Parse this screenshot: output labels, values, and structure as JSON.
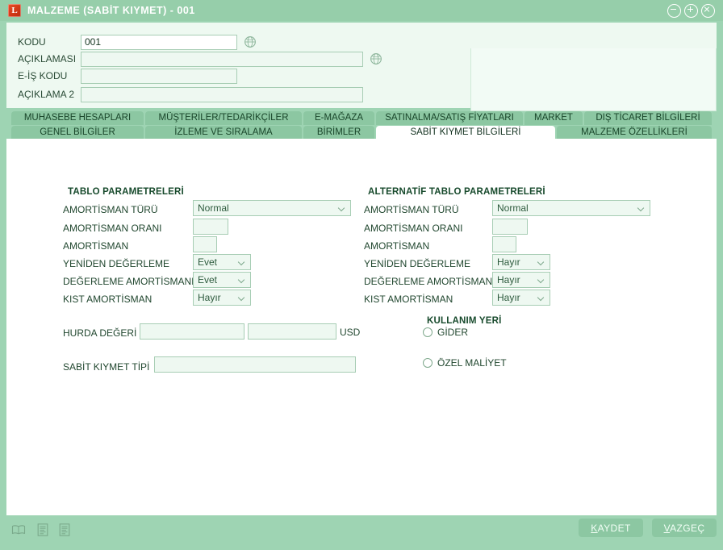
{
  "theme": {
    "window_bg": "#9ed4b3",
    "titlebar_bg": "#96ceaa",
    "tab_bg": "#8cc7a2",
    "tab_active_bg": "#ffffff",
    "content_bg": "#ffffff",
    "field_bg": "#eef8f1",
    "field_border": "#a7cdb4",
    "text": "#21472f",
    "accent_icon": "#e8502a"
  },
  "titlebar": {
    "app_icon": "logo-app-icon",
    "app_icon_letter": "L",
    "title": "MALZEME (SABİT KIYMET) - 001",
    "buttons": [
      {
        "name": "minimize-button",
        "glyph": "minus"
      },
      {
        "name": "maximize-button",
        "glyph": "plus"
      },
      {
        "name": "close-button",
        "glyph": "cross"
      }
    ]
  },
  "header": {
    "fields": [
      {
        "label": "KODU",
        "value": "001",
        "placeholder": "",
        "globe": true
      },
      {
        "label": "AÇIKLAMASI",
        "value": "",
        "placeholder": "",
        "globe": true
      },
      {
        "label": "E-İŞ KODU",
        "value": "",
        "placeholder": "",
        "globe": false
      },
      {
        "label": "AÇIKLAMA 2",
        "value": "",
        "placeholder": "",
        "globe": false
      }
    ],
    "globe_icon": "globe-icon",
    "photo_panel": "item-image-panel"
  },
  "tabs": {
    "row1": [
      {
        "label": "MUHASEBE HESAPLARI",
        "active": false
      },
      {
        "label": "MÜŞTERİLER/TEDARİKÇİLER",
        "active": false
      },
      {
        "label": "E-MAĞAZA",
        "active": false
      },
      {
        "label": "SATINALMA/SATIŞ FİYATLARI",
        "active": false
      },
      {
        "label": "MARKET",
        "active": false
      },
      {
        "label": "DIŞ TİCARET BİLGİLERİ",
        "active": false
      }
    ],
    "row2": [
      {
        "label": "GENEL BİLGİLER",
        "active": false
      },
      {
        "label": "İZLEME VE SIRALAMA",
        "active": false
      },
      {
        "label": "BİRİMLER",
        "active": false
      },
      {
        "label": "SABİT KIYMET BİLGİLERİ",
        "active": true
      },
      {
        "label": "MALZEME ÖZELLİKLERİ",
        "active": false
      }
    ]
  },
  "main": {
    "table_params": {
      "title": "TABLO PARAMETRELERİ",
      "rows": [
        {
          "label": "AMORTİSMAN TÜRÜ",
          "type": "select",
          "value": "Normal"
        },
        {
          "label": "AMORTİSMAN ORANI",
          "type": "input",
          "value": ""
        },
        {
          "label": "AMORTİSMAN",
          "type": "input",
          "value": ""
        },
        {
          "label": "YENİDEN DEĞERLEME",
          "type": "select",
          "value": "Evet"
        },
        {
          "label": "DEĞERLEME AMORTİSMANI",
          "type": "select",
          "value": "Evet"
        },
        {
          "label": "KIST AMORTİSMAN",
          "type": "select",
          "value": "Hayır"
        }
      ]
    },
    "alt_table_params": {
      "title": "ALTERNATİF TABLO PARAMETRELERİ",
      "rows": [
        {
          "label": "AMORTİSMAN TÜRÜ",
          "type": "select",
          "value": "Normal"
        },
        {
          "label": "AMORTİSMAN ORANI",
          "type": "input",
          "value": ""
        },
        {
          "label": "AMORTİSMAN",
          "type": "input",
          "value": ""
        },
        {
          "label": "YENİDEN DEĞERLEME",
          "type": "select",
          "value": "Hayır"
        },
        {
          "label": "DEĞERLEME AMORTİSMANI",
          "type": "select",
          "value": "Hayır"
        },
        {
          "label": "KIST AMORTİSMAN",
          "type": "select",
          "value": "Hayır"
        }
      ]
    },
    "scrap": {
      "label": "HURDA DEĞERİ",
      "value1": "",
      "value2": "",
      "currency": "USD"
    },
    "asset_type": {
      "label": "SABİT KIYMET TİPİ",
      "value": ""
    },
    "usage": {
      "title": "KULLANIM YERİ",
      "options": [
        {
          "label": "GİDER",
          "checked": false
        },
        {
          "label": "ÖZEL MALİYET",
          "checked": false
        }
      ]
    }
  },
  "footer": {
    "icons": [
      {
        "name": "notes-book-icon"
      },
      {
        "name": "document-lines-icon"
      },
      {
        "name": "document-lines-alt-icon"
      }
    ],
    "save_label_accel": "K",
    "save_label_rest": "AYDET",
    "cancel_label_accel": "V",
    "cancel_label_rest": "AZGEÇ"
  }
}
